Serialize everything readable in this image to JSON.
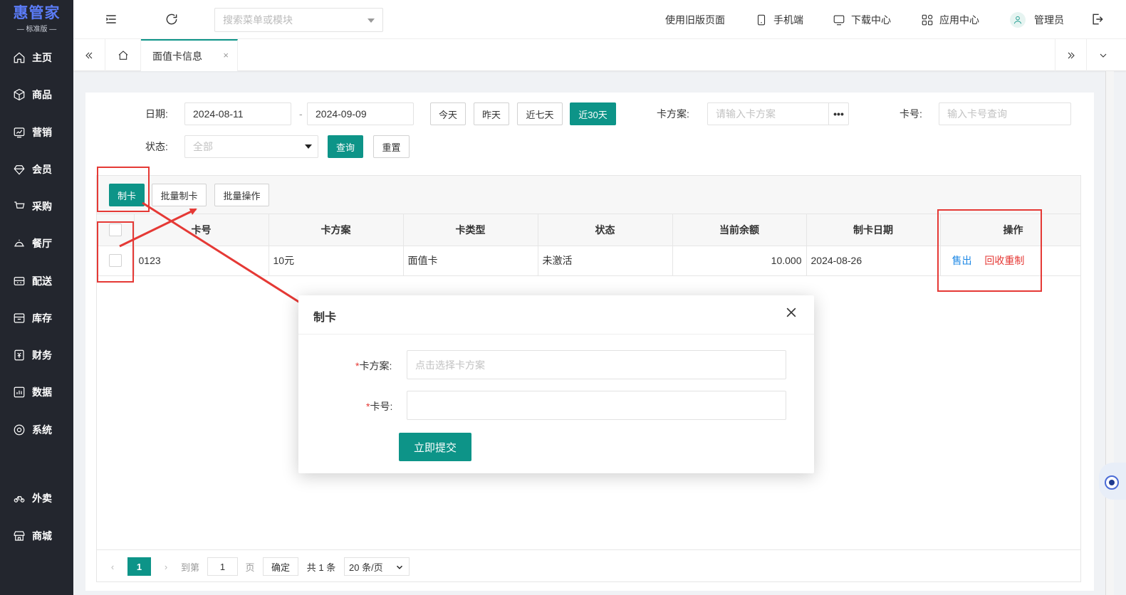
{
  "logo": {
    "brand": "惠管家",
    "edition": "— 标准版 —"
  },
  "sidebar": {
    "items": [
      {
        "label": "主页",
        "icon": "home-icon"
      },
      {
        "label": "商品",
        "icon": "box-icon"
      },
      {
        "label": "营销",
        "icon": "chart-icon"
      },
      {
        "label": "会员",
        "icon": "gem-icon"
      },
      {
        "label": "采购",
        "icon": "cart-icon"
      },
      {
        "label": "餐厅",
        "icon": "dish-icon"
      },
      {
        "label": "配送",
        "icon": "delivery-icon"
      },
      {
        "label": "库存",
        "icon": "archive-icon"
      },
      {
        "label": "财务",
        "icon": "finance-icon"
      },
      {
        "label": "数据",
        "icon": "bar-chart-icon"
      },
      {
        "label": "系统",
        "icon": "settings-icon"
      },
      {
        "label": "外卖",
        "icon": "bike-icon"
      },
      {
        "label": "商城",
        "icon": "store-icon"
      }
    ]
  },
  "header": {
    "search_placeholder": "搜索菜单或模块",
    "old_version": "使用旧版页面",
    "mobile": "手机端",
    "download": "下载中心",
    "apps": "应用中心",
    "user": "管理员"
  },
  "tabs": {
    "active": "面值卡信息",
    "close": "×"
  },
  "filters": {
    "date_label": "日期:",
    "date_start": "2024-08-11",
    "date_sep": "-",
    "date_end": "2024-09-09",
    "today": "今天",
    "yesterday": "昨天",
    "last7": "近七天",
    "last30": "近30天",
    "plan_label": "卡方案:",
    "plan_placeholder": "请输入卡方案",
    "plan_more": "•••",
    "cardno_label": "卡号:",
    "cardno_placeholder": "输入卡号查询",
    "status_label": "状态:",
    "status_value": "全部",
    "query": "查询",
    "reset": "重置"
  },
  "toolbar": {
    "make_card": "制卡",
    "batch_make": "批量制卡",
    "batch_ops": "批量操作"
  },
  "table": {
    "headers": [
      "卡号",
      "卡方案",
      "卡类型",
      "状态",
      "当前余额",
      "制卡日期",
      "操作"
    ],
    "rows": [
      {
        "card_no": "0123",
        "plan": "10元",
        "type": "面值卡",
        "status": "未激活",
        "balance": "10.000",
        "date": "2024-08-26",
        "op_sell": "售出",
        "op_recycle": "回收重制"
      }
    ]
  },
  "pager": {
    "current": "1",
    "goto_label": "到第",
    "goto_value": "1",
    "page_unit": "页",
    "confirm": "确定",
    "total": "共 1 条",
    "page_size": "20 条/页"
  },
  "modal": {
    "title": "制卡",
    "plan_label": "卡方案:",
    "plan_placeholder": "点击选择卡方案",
    "cardno_label": "卡号:",
    "cardno_value": "",
    "required_mark": "*",
    "submit": "立即提交"
  },
  "colors": {
    "primary": "#0d9488",
    "sidebar": "#23262e",
    "annotation": "#e53935",
    "link": "#1e88e5"
  }
}
